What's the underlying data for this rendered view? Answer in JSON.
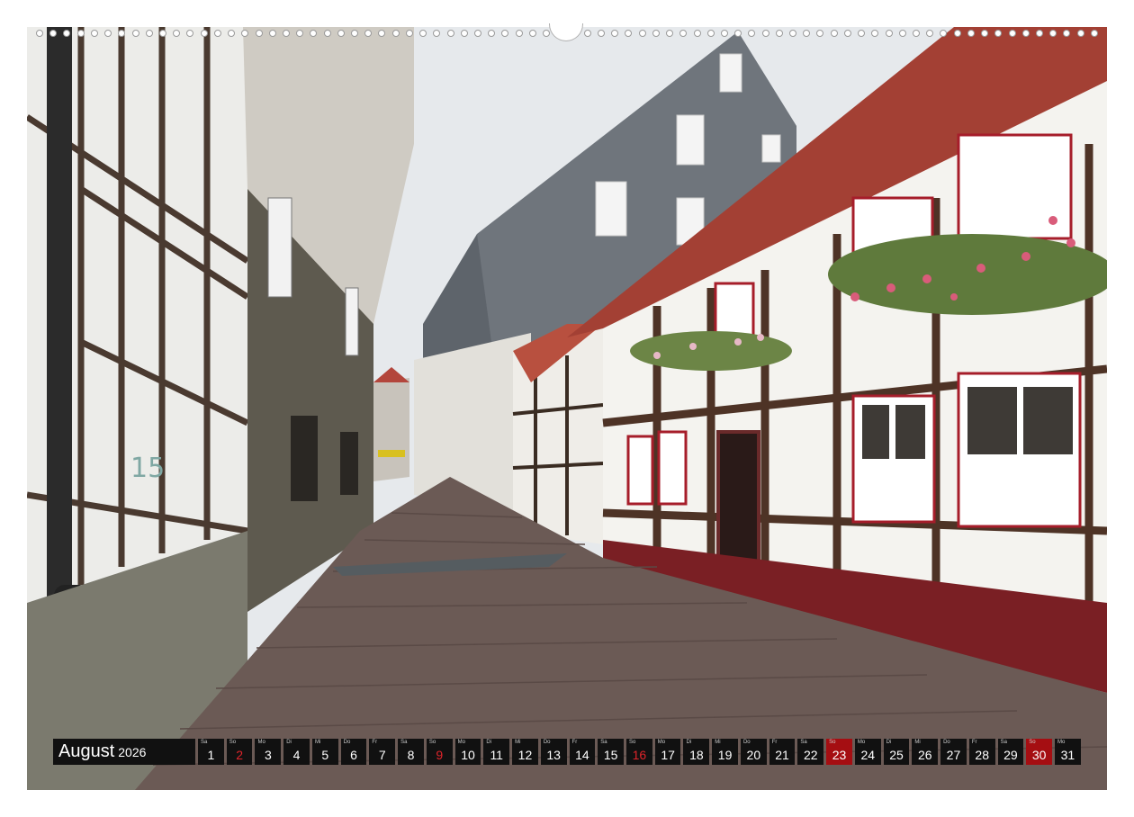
{
  "calendar": {
    "month": "August",
    "year": "2026",
    "days": [
      {
        "wd": "Sa",
        "num": "1",
        "style": "normal"
      },
      {
        "wd": "So",
        "num": "2",
        "style": "sunday"
      },
      {
        "wd": "Mo",
        "num": "3",
        "style": "normal"
      },
      {
        "wd": "Di",
        "num": "4",
        "style": "normal"
      },
      {
        "wd": "Mi",
        "num": "5",
        "style": "normal"
      },
      {
        "wd": "Do",
        "num": "6",
        "style": "normal"
      },
      {
        "wd": "Fr",
        "num": "7",
        "style": "normal"
      },
      {
        "wd": "Sa",
        "num": "8",
        "style": "normal"
      },
      {
        "wd": "So",
        "num": "9",
        "style": "sunday"
      },
      {
        "wd": "Mo",
        "num": "10",
        "style": "normal"
      },
      {
        "wd": "Di",
        "num": "11",
        "style": "normal"
      },
      {
        "wd": "Mi",
        "num": "12",
        "style": "normal"
      },
      {
        "wd": "Do",
        "num": "13",
        "style": "normal"
      },
      {
        "wd": "Fr",
        "num": "14",
        "style": "normal"
      },
      {
        "wd": "Sa",
        "num": "15",
        "style": "normal"
      },
      {
        "wd": "So",
        "num": "16",
        "style": "sunday"
      },
      {
        "wd": "Mo",
        "num": "17",
        "style": "normal"
      },
      {
        "wd": "Di",
        "num": "18",
        "style": "normal"
      },
      {
        "wd": "Mi",
        "num": "19",
        "style": "normal"
      },
      {
        "wd": "Do",
        "num": "20",
        "style": "normal"
      },
      {
        "wd": "Fr",
        "num": "21",
        "style": "normal"
      },
      {
        "wd": "Sa",
        "num": "22",
        "style": "normal"
      },
      {
        "wd": "So",
        "num": "23",
        "style": "holiday"
      },
      {
        "wd": "Mo",
        "num": "24",
        "style": "normal"
      },
      {
        "wd": "Di",
        "num": "25",
        "style": "normal"
      },
      {
        "wd": "Mi",
        "num": "26",
        "style": "normal"
      },
      {
        "wd": "Do",
        "num": "27",
        "style": "normal"
      },
      {
        "wd": "Fr",
        "num": "28",
        "style": "normal"
      },
      {
        "wd": "Sa",
        "num": "29",
        "style": "normal"
      },
      {
        "wd": "So",
        "num": "30",
        "style": "holiday"
      },
      {
        "wd": "Mo",
        "num": "31",
        "style": "normal"
      }
    ]
  },
  "colors": {
    "strip": "#111111",
    "sunday_text": "#e0242a",
    "holiday_bg": "#a50e12"
  }
}
